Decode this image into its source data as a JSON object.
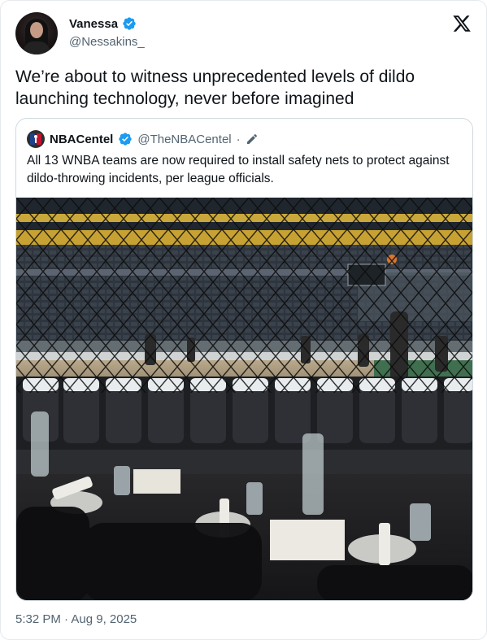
{
  "tweet": {
    "display_name": "Vanessa",
    "handle": "@Nessakins_",
    "text": "We’re about to witness unprecedented levels of dildo launching technology, never before imagined",
    "timestamp": "5:32 PM · Aug 9, 2025"
  },
  "quote": {
    "display_name": "NBACentel",
    "handle": "@TheNBACentel",
    "separator": "·",
    "text": "All 13 WNBA teams are now required to install safety nets to protect against dildo-throwing incidents, per league officials.",
    "image_icon": "arena-photo"
  },
  "icons": {
    "verified": "verified-badge-icon",
    "platform": "x-logo-icon",
    "edit": "pencil-icon"
  },
  "colors": {
    "verified_blue": "#1d9bf0",
    "text_primary": "#0f1419",
    "text_secondary": "#536471",
    "border": "#cfd9de"
  }
}
